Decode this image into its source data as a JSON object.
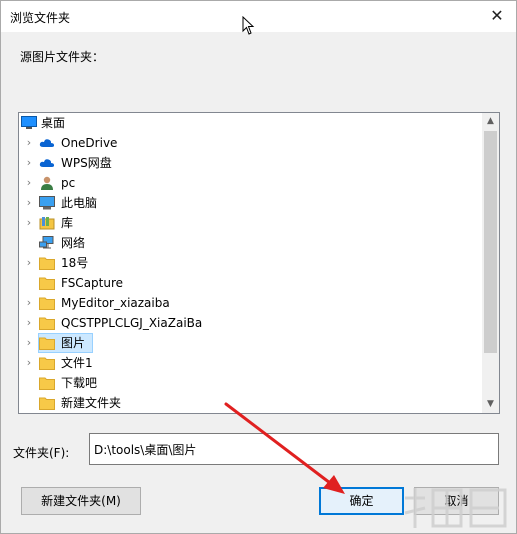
{
  "window": {
    "title": "浏览文件夹",
    "close_glyph": "✕"
  },
  "prompt": "源图片文件夹：",
  "tree": {
    "items": [
      {
        "label": "桌面",
        "icon": "desktop-icon",
        "expander": "",
        "root": true
      },
      {
        "label": "OneDrive",
        "icon": "cloud-icon",
        "expander": "›"
      },
      {
        "label": "WPS网盘",
        "icon": "cloud-icon",
        "expander": "›"
      },
      {
        "label": "pc",
        "icon": "user-icon",
        "expander": "›"
      },
      {
        "label": "此电脑",
        "icon": "computer-icon",
        "expander": "›"
      },
      {
        "label": "库",
        "icon": "library-icon",
        "expander": "›"
      },
      {
        "label": "网络",
        "icon": "network-icon",
        "expander": ""
      },
      {
        "label": "18号",
        "icon": "folder-icon",
        "expander": "›"
      },
      {
        "label": "FSCapture",
        "icon": "folder-icon",
        "expander": ""
      },
      {
        "label": "MyEditor_xiazaiba",
        "icon": "folder-icon",
        "expander": "›"
      },
      {
        "label": "QCSTPPLCLGJ_XiaZaiBa",
        "icon": "folder-icon",
        "expander": "›"
      },
      {
        "label": "图片",
        "icon": "folder-icon",
        "expander": "›",
        "selected": true
      },
      {
        "label": "文件1",
        "icon": "folder-icon",
        "expander": "›"
      },
      {
        "label": "下载吧",
        "icon": "folder-icon",
        "expander": ""
      },
      {
        "label": "新建文件夹",
        "icon": "folder-icon",
        "expander": ""
      }
    ],
    "scroll_up": "▲",
    "scroll_down": "▼"
  },
  "folder": {
    "label": "文件夹(F):",
    "value": "D:\\tools\\桌面\\图片"
  },
  "buttons": {
    "new_folder": "新建文件夹(M)",
    "ok": "确定",
    "cancel": "取消"
  },
  "annotation": {
    "arrow_color": "#e02020"
  },
  "watermark": {
    "text": "下载吧"
  },
  "colors": {
    "selection": "#cce8ff",
    "default_button_border": "#0078d7",
    "folder": "#f7c948"
  }
}
